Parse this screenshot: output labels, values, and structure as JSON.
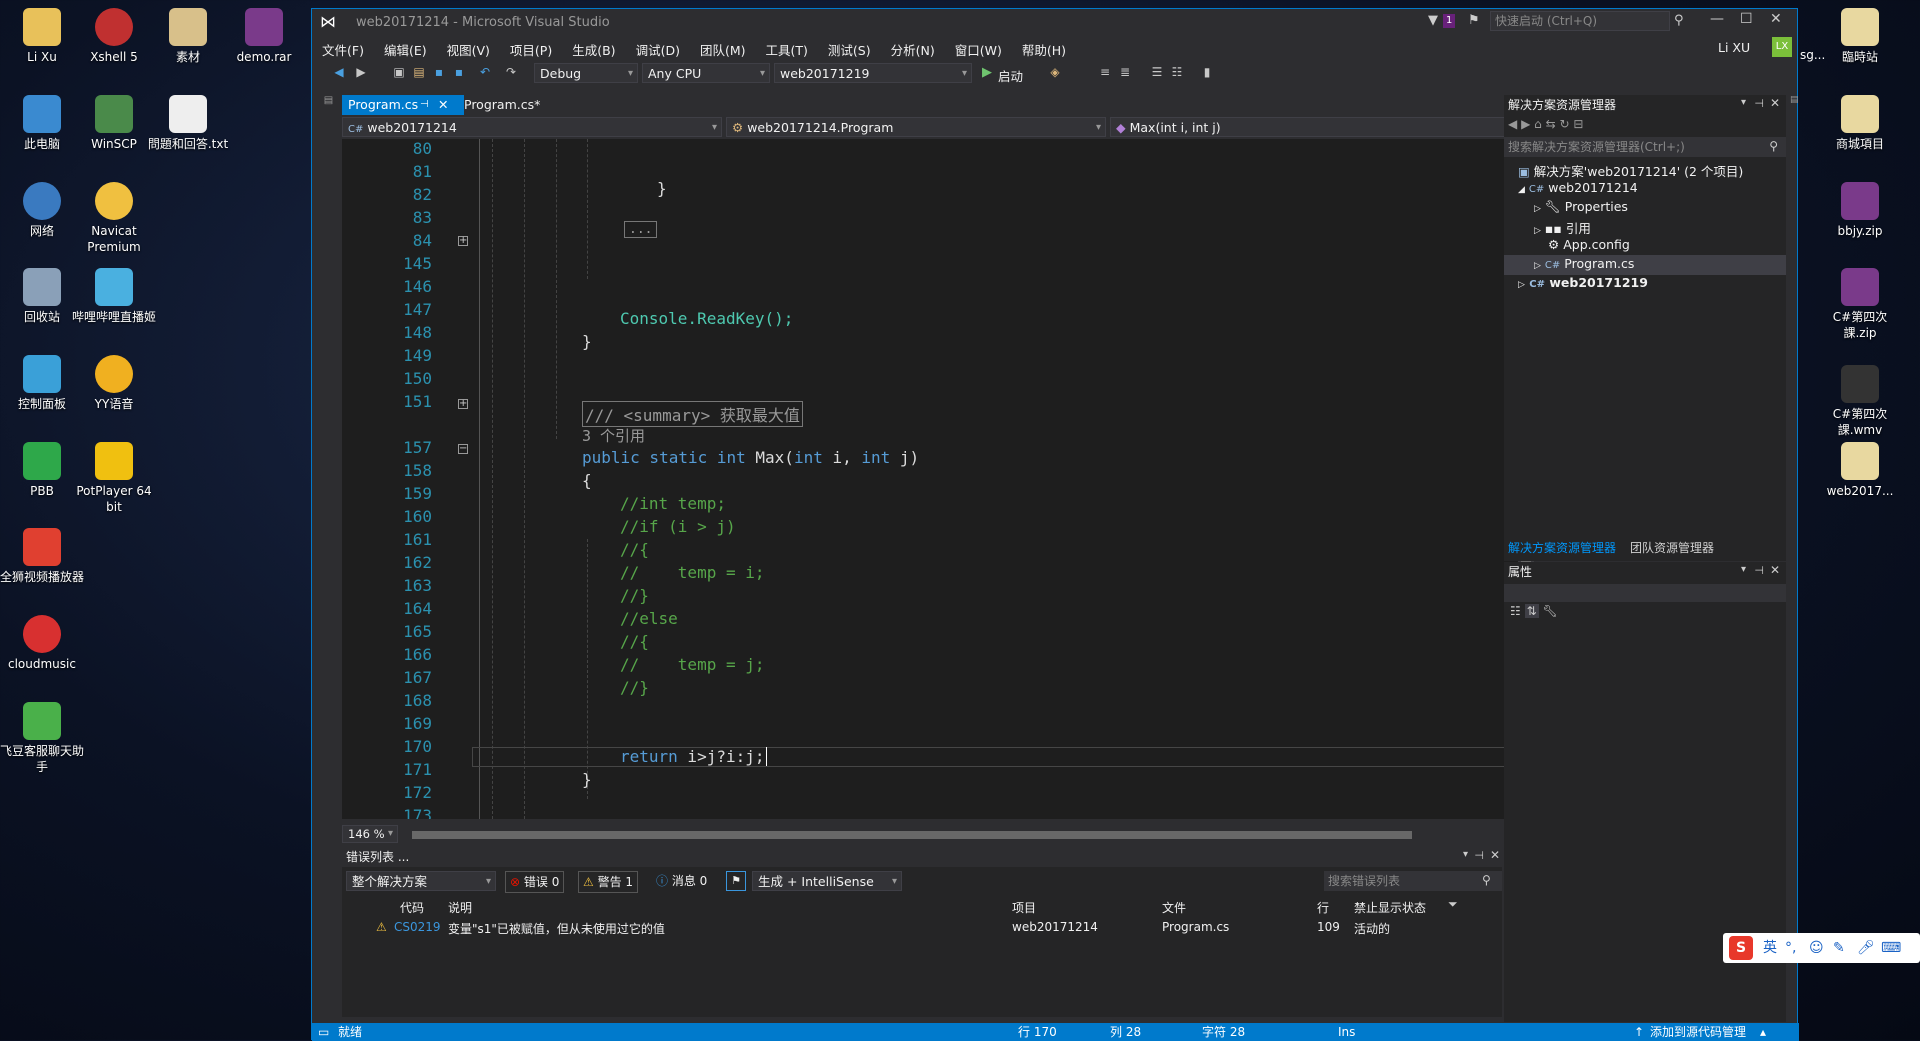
{
  "desktop": {
    "left_icons": [
      "Li Xu",
      "Xshell 5",
      "素材",
      "demo.rar",
      "此电脑",
      "WinSCP",
      "問題和回答.txt",
      "网络",
      "Navicat Premium",
      "回收站",
      "哔哩哔哩直播姬",
      "控制面板",
      "YY语音",
      "PBB",
      "PotPlayer 64 bit",
      "全狮视频播放器",
      "cloudmusic",
      "飞豆客服聊天助手"
    ],
    "right_icons": [
      "臨時站",
      "商城項目",
      "bbjy.zip",
      "C#第四次課.zip",
      "C#第四次課.wmv",
      "web2017..."
    ],
    "right_partial": "sg..."
  },
  "window": {
    "title": "web20171214 - Microsoft Visual Studio",
    "filter_badge": "1",
    "quick_launch": "快速启动 (Ctrl+Q)",
    "user_name": "Li XU",
    "user_initials": "LX",
    "colors": {
      "accent": "#007acc",
      "background": "#2d2d30",
      "editor": "#1e1e1e"
    }
  },
  "menu": [
    "文件(F)",
    "编辑(E)",
    "视图(V)",
    "项目(P)",
    "生成(B)",
    "调试(D)",
    "团队(M)",
    "工具(T)",
    "测试(S)",
    "分析(N)",
    "窗口(W)",
    "帮助(H)"
  ],
  "toolbar": {
    "config": "Debug",
    "platform": "Any CPU",
    "startup_project": "web20171219",
    "start_label": "启动"
  },
  "editor": {
    "tabs": [
      {
        "label": "Program.cs",
        "active": true
      },
      {
        "label": "Program.cs*",
        "active": false
      }
    ],
    "nav": {
      "project": "web20171214",
      "class": "web20171214.Program",
      "member": "Max(int i, int j)"
    },
    "line_numbers": [
      "80",
      "81",
      "82",
      "83",
      "84",
      "145",
      "146",
      "147",
      "148",
      "149",
      "150",
      "151",
      "157",
      "158",
      "159",
      "160",
      "161",
      "162",
      "163",
      "164",
      "165",
      "166",
      "167",
      "168",
      "169",
      "170",
      "171",
      "172",
      "173"
    ],
    "code": {
      "l82": "}",
      "l84": "...",
      "l147": "Console.ReadKey();",
      "l148": "}",
      "l151": "/// <summary> 获取最大值",
      "refs": "3 个引用",
      "l157_kw": "public static int",
      "l157_name": " Max(",
      "l157_int1": "int",
      "l157_i": " i, ",
      "l157_int2": "int",
      "l157_j": " j)",
      "l158": "{",
      "l159": "//int temp;",
      "l160": "//if (i > j)",
      "l161": "//{",
      "l162": "//    temp = i;",
      "l163": "//}",
      "l164": "//else",
      "l165": "//{",
      "l166": "//    temp = j;",
      "l167": "//}",
      "l170_kw": "return",
      "l170_rest": " i>j?i:j;",
      "l171": "}"
    },
    "zoom": "146 %"
  },
  "solution_explorer": {
    "title": "解决方案资源管理器",
    "search_placeholder": "搜索解决方案资源管理器(Ctrl+;)",
    "items": [
      "解决方案'web20171214' (2 个项目)",
      "web20171214",
      "Properties",
      "引用",
      "App.config",
      "Program.cs",
      "web20171219"
    ],
    "bottom_tabs": [
      "解决方案资源管理器",
      "团队资源管理器"
    ]
  },
  "properties": {
    "title": "属性"
  },
  "error_list": {
    "title": "错误列表 ...",
    "scope": "整个解决方案",
    "errors": "错误 0",
    "warnings": "警告 1",
    "messages": "消息 0",
    "build_filter": "生成 + IntelliSense",
    "search_placeholder": "搜索错误列表",
    "columns": [
      "代码",
      "说明",
      "项目",
      "文件",
      "行",
      "禁止显示状态"
    ],
    "rows": [
      {
        "code": "CS0219",
        "desc": "变量\"s1\"已被赋值，但从未使用过它的值",
        "project": "web20171214",
        "file": "Program.cs",
        "line": "109",
        "state": "活动的"
      }
    ]
  },
  "statusbar": {
    "ready": "就绪",
    "line": "行 170",
    "col": "列 28",
    "char": "字符 28",
    "mode": "Ins",
    "source_control": "添加到源代码管理"
  },
  "ime": {
    "lang": "英"
  }
}
